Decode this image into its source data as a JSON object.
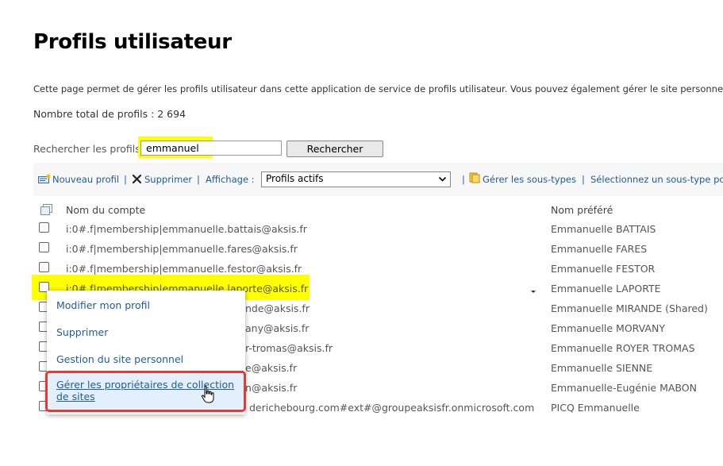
{
  "page": {
    "title": "Profils utilisateur",
    "description": "Cette page permet de gérer les profils utilisateur dans cette application de service de profils utilisateur. Vous pouvez également gérer le site personnel d’",
    "total": "Nombre total de profils : 2 694"
  },
  "search": {
    "label": "Rechercher les profils",
    "value": "emmanuel",
    "button": "Rechercher"
  },
  "toolbar": {
    "new_profile": "Nouveau profil",
    "delete": "Supprimer",
    "view_label": "Affichage :",
    "view_value": "Profils actifs",
    "manage_subtypes": "Gérer les sous-types",
    "select_subtype": "Sélectionnez un sous-type po",
    "separator": "|"
  },
  "table": {
    "headers": {
      "account": "Nom du compte",
      "preferred": "Nom préféré"
    },
    "rows": [
      {
        "account": "i:0#.f|membership|emmanuelle.battais@aksis.fr",
        "preferred": "Emmanuelle BATTAIS"
      },
      {
        "account": "i:0#.f|membership|emmanuelle.fares@aksis.fr",
        "preferred": "Emmanuelle FARES"
      },
      {
        "account": "i:0#.f|membership|emmanuelle.festor@aksis.fr",
        "preferred": "Emmanuelle FESTOR"
      },
      {
        "account": "i:0#.f|membership|emmanuelle.laporte@aksis.fr",
        "preferred": "Emmanuelle LAPORTE"
      },
      {
        "account": "nde@aksis.fr",
        "preferred": "Emmanuelle MIRANDE (Shared)"
      },
      {
        "account": "any@aksis.fr",
        "preferred": "Emmanuelle MORVANY"
      },
      {
        "account": "r-tromas@aksis.fr",
        "preferred": "Emmanuelle ROYER TROMAS"
      },
      {
        "account": "e@aksis.fr",
        "preferred": "Emmanuelle SIENNE"
      },
      {
        "account": "n@aksis.fr",
        "preferred": "Emmanuelle-Eugénie MABON"
      },
      {
        "account": "derichebourg.com#ext#@groupeaksisfr.onmicrosoft.com",
        "preferred": "PICQ Emmanuelle"
      }
    ]
  },
  "context_menu": {
    "items": [
      "Modifier mon profil",
      "Supprimer",
      "Gestion du site personnel",
      "Gérer les propriétaires de collection de sites"
    ]
  },
  "colors": {
    "link": "#1f5c99",
    "highlight": "#ffff00",
    "focus_border": "#e53935"
  }
}
